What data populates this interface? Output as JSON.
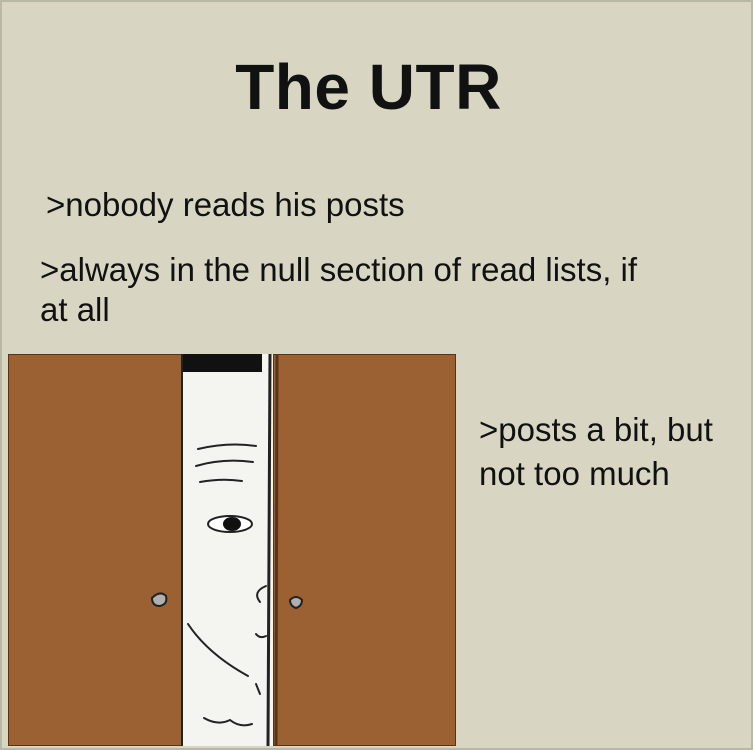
{
  "title": "The UTR",
  "lines": [
    ">nobody reads his posts",
    ">always in the null section of read lists, if at all",
    ">posts a bit, but not too much"
  ],
  "colors": {
    "background": "#d8d6c3",
    "door": "#9b6132",
    "door_outline": "#5a3417",
    "knob": "#b0b0b0"
  },
  "illustration": {
    "subject": "face-peeking-through-door-gap-icon"
  }
}
